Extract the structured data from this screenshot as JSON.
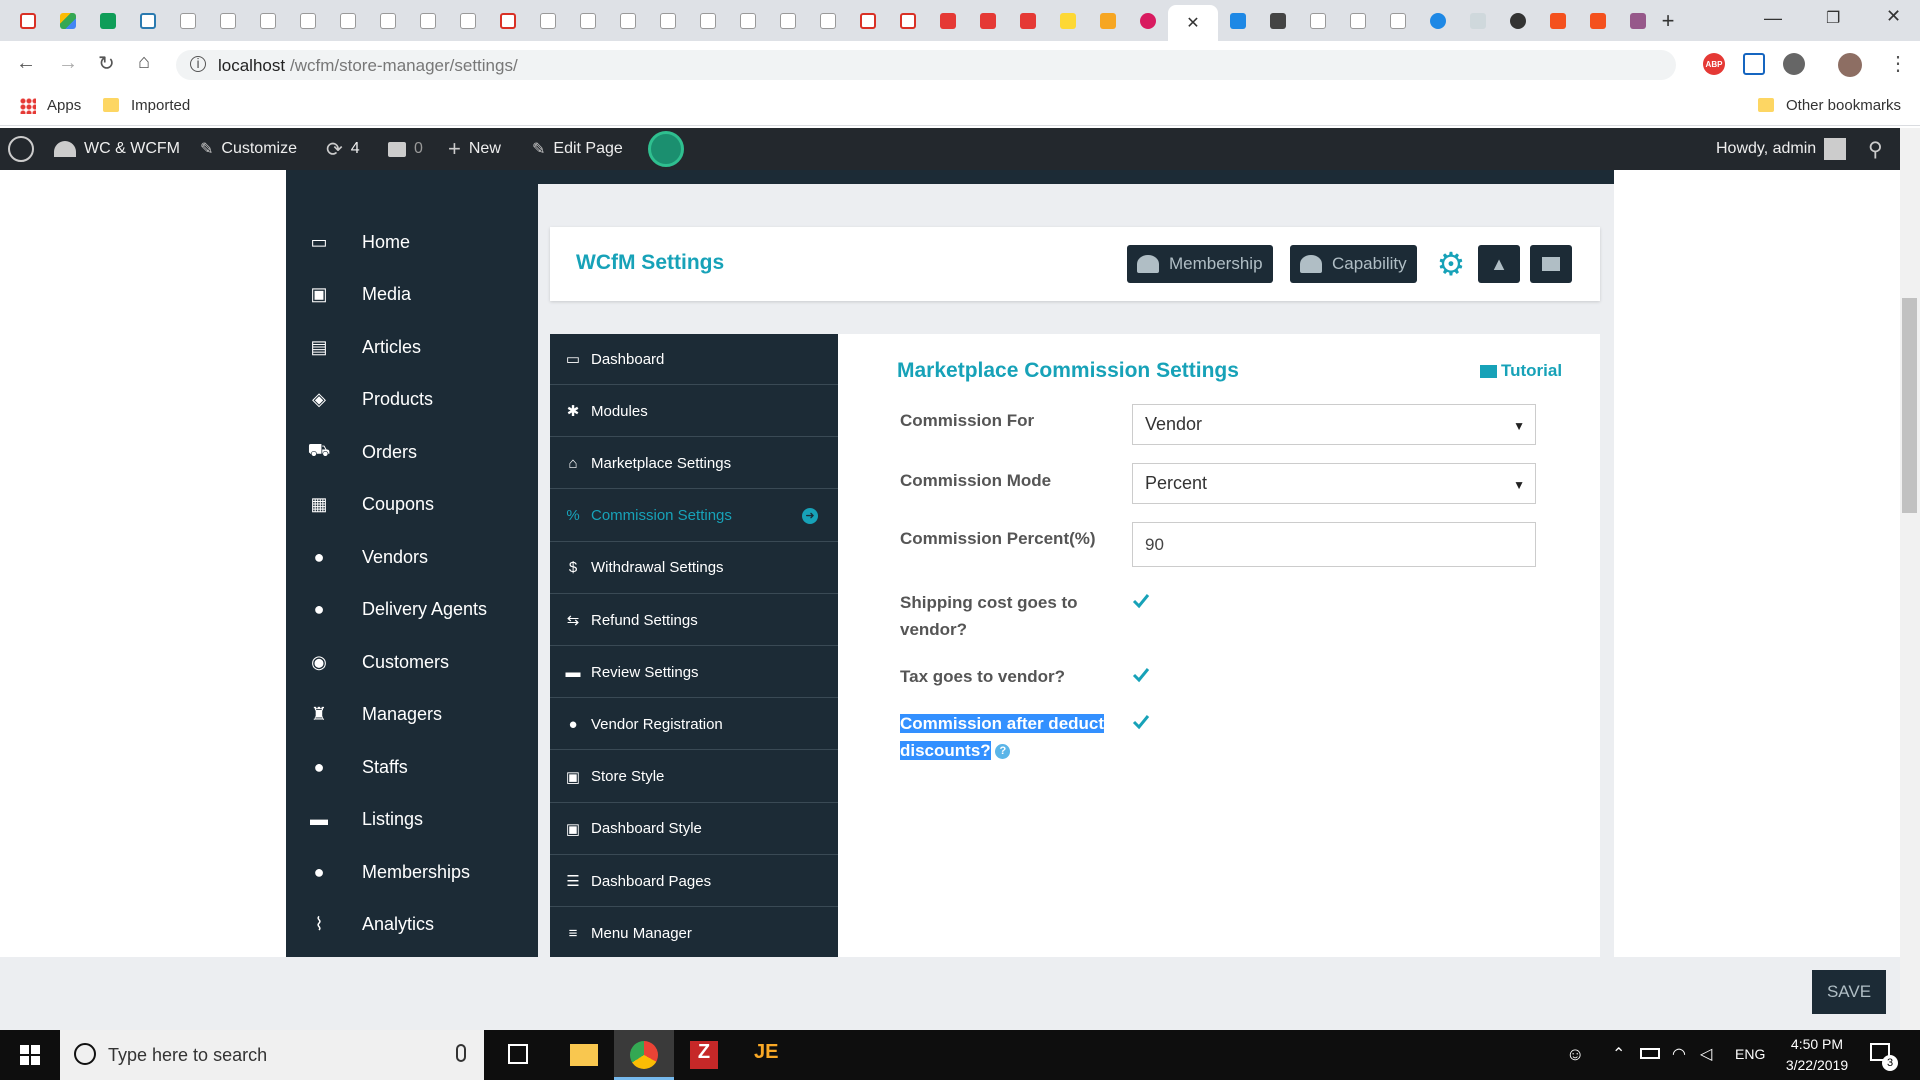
{
  "browser": {
    "url_host": "localhost",
    "url_path": "/wcfm/store-manager/settings/",
    "bookmarks": {
      "apps": "Apps",
      "imported": "Imported",
      "other": "Other bookmarks"
    }
  },
  "wpbar": {
    "site": "WC & WCFM",
    "customize": "Customize",
    "updates": "4",
    "comments": "0",
    "new": "New",
    "edit_page": "Edit Page",
    "howdy": "Howdy, admin"
  },
  "leftnav": [
    {
      "label": "Home",
      "icon": "monitor-icon"
    },
    {
      "label": "Media",
      "icon": "image-icon"
    },
    {
      "label": "Articles",
      "icon": "file-icon"
    },
    {
      "label": "Products",
      "icon": "cube-icon"
    },
    {
      "label": "Orders",
      "icon": "cart-icon"
    },
    {
      "label": "Coupons",
      "icon": "gift-icon"
    },
    {
      "label": "Vendors",
      "icon": "user-icon"
    },
    {
      "label": "Delivery Agents",
      "icon": "user-icon"
    },
    {
      "label": "Customers",
      "icon": "user-circle-icon"
    },
    {
      "label": "Managers",
      "icon": "user-secret-icon"
    },
    {
      "label": "Staffs",
      "icon": "user-icon"
    },
    {
      "label": "Listings",
      "icon": "briefcase-icon"
    },
    {
      "label": "Memberships",
      "icon": "user-plus-icon"
    },
    {
      "label": "Analytics",
      "icon": "chart-icon"
    }
  ],
  "header": {
    "title": "WCfM Settings",
    "membership": "Membership",
    "capability": "Capability"
  },
  "subnav": [
    {
      "label": "Dashboard",
      "icon": "monitor-icon"
    },
    {
      "label": "Modules",
      "icon": "modules-icon"
    },
    {
      "label": "Marketplace Settings",
      "icon": "home-icon"
    },
    {
      "label": "Commission Settings",
      "icon": "percent-icon",
      "active": true
    },
    {
      "label": "Withdrawal Settings",
      "icon": "dollar-icon"
    },
    {
      "label": "Refund Settings",
      "icon": "retweet-icon"
    },
    {
      "label": "Review Settings",
      "icon": "comment-icon"
    },
    {
      "label": "Vendor Registration",
      "icon": "user-icon"
    },
    {
      "label": "Store Style",
      "icon": "image-icon"
    },
    {
      "label": "Dashboard Style",
      "icon": "image-icon"
    },
    {
      "label": "Dashboard Pages",
      "icon": "list-icon"
    },
    {
      "label": "Menu Manager",
      "icon": "bars-icon"
    }
  ],
  "form": {
    "section_title": "Marketplace Commission Settings",
    "tutorial": "Tutorial",
    "commission_for_label": "Commission For",
    "commission_for_value": "Vendor",
    "commission_mode_label": "Commission Mode",
    "commission_mode_value": "Percent",
    "commission_percent_label": "Commission Percent(%)",
    "commission_percent_value": "90",
    "shipping_label": "Shipping cost goes to vendor?",
    "tax_label": "Tax goes to vendor?",
    "discount_label": "Commission after deduct discounts?"
  },
  "save": "SAVE",
  "taskbar": {
    "search_placeholder": "Type here to search",
    "lang": "ENG",
    "time": "4:50 PM",
    "date": "3/22/2019",
    "notifications": "3"
  },
  "colors": {
    "accent": "#17a2b8",
    "nav_bg": "#1c2b36",
    "wpbar": "#23282d"
  }
}
